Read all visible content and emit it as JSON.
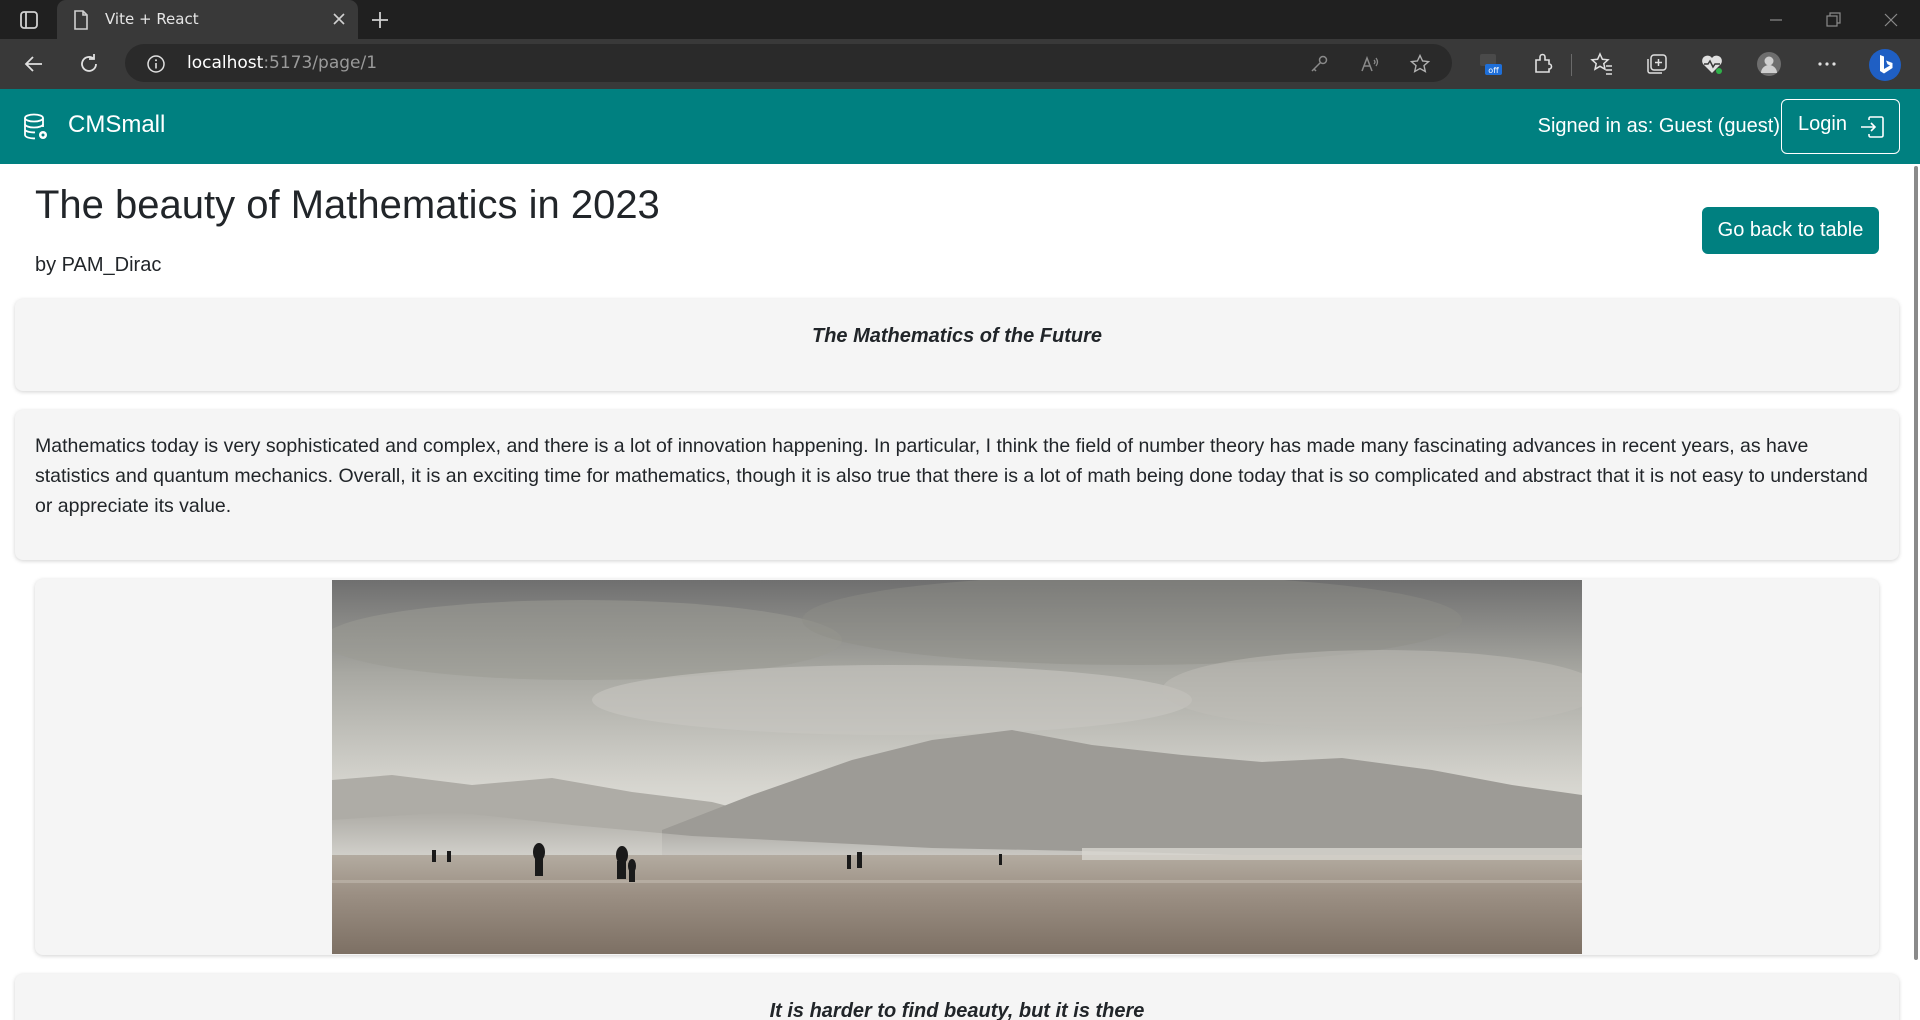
{
  "browser": {
    "tab_title": "Vite + React",
    "url_host": "localhost",
    "url_rest": ":5173/page/1"
  },
  "navbar": {
    "brand": "CMSmall",
    "signed_in": "Signed in as: Guest (guest)",
    "login_label": "Login",
    "accent_color": "#008080"
  },
  "page": {
    "title": "The beauty of Mathematics in 2023",
    "author": "by PAM_Dirac",
    "back_button": "Go back to table",
    "blocks": [
      {
        "type": "header",
        "text": "The Mathematics of the Future"
      },
      {
        "type": "paragraph",
        "text": "Mathematics today is very sophisticated and complex, and there is a lot of innovation happening. In particular, I think the field of number theory has made many fascinating advances in recent years, as have statistics and quantum mechanics. Overall, it is an exciting time for mathematics, though it is also true that there is a lot of math being done today that is so complicated and abstract that it is not easy to understand or appreciate its value."
      },
      {
        "type": "image",
        "subject": "misty mountains over a beach with people walking"
      },
      {
        "type": "header",
        "text": "It is harder to find beauty, but it is there"
      }
    ]
  },
  "icons": {
    "tab_actions": "tab-actions-icon",
    "page": "page-icon",
    "close": "close-icon",
    "new_tab": "plus-icon",
    "back": "back-arrow-icon",
    "refresh": "refresh-icon",
    "info": "info-icon",
    "brand": "database-gear-icon",
    "login": "box-arrow-in-right-icon"
  }
}
